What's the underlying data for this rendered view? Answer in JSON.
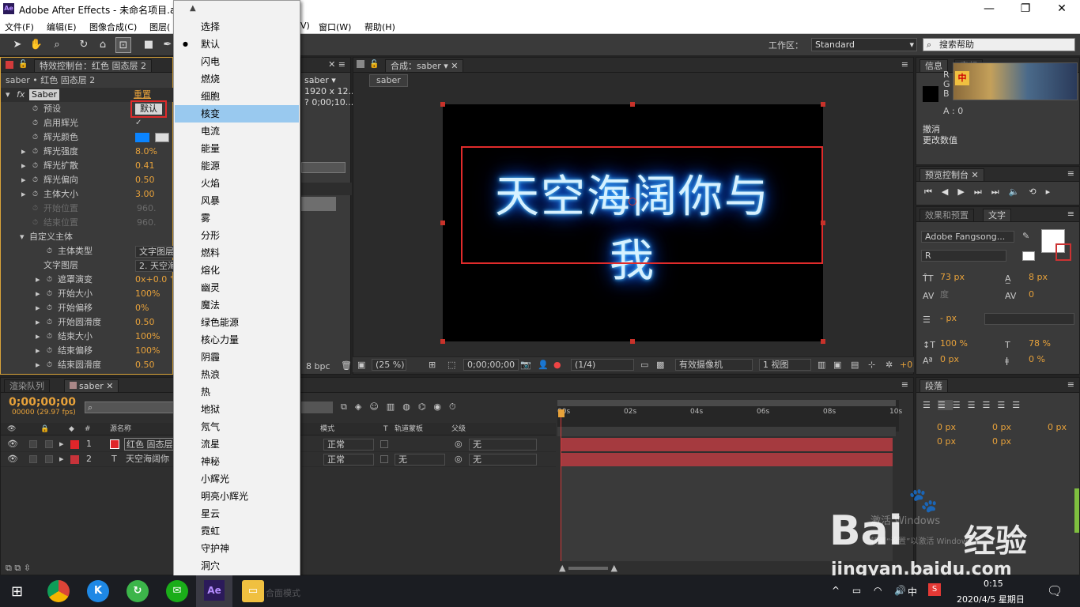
{
  "window": {
    "app_icon": "Ae",
    "title": "Adobe After Effects - 未命名项目.a",
    "min_glyph": "—",
    "max_glyph": "❐",
    "close_glyph": "✕"
  },
  "menu": [
    "文件(F)",
    "编辑(E)",
    "图像合成(C)",
    "图层(",
    "V)",
    "窗口(W)",
    "帮助(H)"
  ],
  "toolbar": {
    "workspace_label": "工作区：",
    "workspace_value": "Standard",
    "help_search_placeholder": "搜索帮助"
  },
  "effect_controls": {
    "tab_label": "特效控制台：红色 固态层",
    "tab_num": "2",
    "layer_path": "saber • 红色 固态层 2",
    "effect_name": "Saber",
    "reset_label": "重置",
    "properties": [
      {
        "label": "预设",
        "value": "默认"
      },
      {
        "label": "启用辉光",
        "value": "✓"
      },
      {
        "label": "辉光颜色",
        "value": ""
      },
      {
        "label": "辉光强度",
        "value": "8.0%"
      },
      {
        "label": "辉光扩散",
        "value": "0.41"
      },
      {
        "label": "辉光偏向",
        "value": "0.50"
      },
      {
        "label": "主体大小",
        "value": "3.00"
      },
      {
        "label": "开始位置",
        "value": "960."
      },
      {
        "label": "结束位置",
        "value": "960."
      },
      {
        "label": "自定义主体",
        "value": ""
      },
      {
        "label": "主体类型",
        "value": "文字图层"
      },
      {
        "label": "文字图层",
        "value": "2. 天空海"
      },
      {
        "label": "遮罩演变",
        "value": "0x+0.0 °"
      },
      {
        "label": "开始大小",
        "value": "100%"
      },
      {
        "label": "开始偏移",
        "value": "0%"
      },
      {
        "label": "开始圆滑度",
        "value": "0.50"
      },
      {
        "label": "结束大小",
        "value": "100%"
      },
      {
        "label": "结束偏移",
        "value": "100%"
      },
      {
        "label": "结束圆滑度",
        "value": "0.50"
      }
    ],
    "glow_color": "#0a84ff"
  },
  "project": {
    "comp_name": "saber ▾",
    "comp_size": "1920 x 12...",
    "comp_duration": "? 0;00;10...",
    "bpc": "8 bpc"
  },
  "preset_menu": {
    "items": [
      "选择",
      "默认",
      "闪电",
      "燃烧",
      "细胞",
      "核变",
      "电流",
      "能量",
      "能源",
      "火焰",
      "风暴",
      "雾",
      "分形",
      "燃料",
      "熔化",
      "幽灵",
      "魔法",
      "绿色能源",
      "核心力量",
      "阴霾",
      "热浪",
      "热",
      "地狱",
      "氖气",
      "流星",
      "神秘",
      "小辉光",
      "明亮小辉光",
      "星云",
      "霓虹",
      "守护神",
      "洞穴"
    ],
    "checked": "默认",
    "highlighted": "核变"
  },
  "composition": {
    "tab_label": "合成：saber",
    "sub_tab": "saber",
    "neon_text": "天空海阔你与我",
    "zoom": "(25 %)",
    "timecode": "0;00;00;00",
    "resolution": "(1/4)",
    "camera": "有效摄像机",
    "views": "1 视图",
    "offset": "+0"
  },
  "info_panel": {
    "tab_info": "信息",
    "tab_audio": "音频",
    "rgba": [
      "R :",
      "G :",
      "B :",
      "A : 0"
    ],
    "undo_label": "撤消",
    "undo_action": "更改数值"
  },
  "preview": {
    "tab_label": "预览控制台"
  },
  "character": {
    "tab_effects": "效果和预置",
    "tab_text": "文字",
    "font": "Adobe Fangsong...",
    "style": "R",
    "size": "73 px",
    "leading": "8 px",
    "tracking_label": "度",
    "tracking": "0",
    "stroke": "- px",
    "vscale": "100 %",
    "hscale": "78 %",
    "baseline": "0 px",
    "tsume": "0 %"
  },
  "paragraph": {
    "tab_label": "段落",
    "indent_left": "0 px",
    "indent_right": "0 px",
    "indent_first": "0 px",
    "space_before": "0 px",
    "space_after": "0 px"
  },
  "timeline": {
    "tab_render": "渲染队列",
    "tab_comp": "saber",
    "timecode": "0;00;00;00",
    "fps": "00000 (29.97 fps)",
    "col_hash": "#",
    "col_source": "源名称",
    "col_mode": "模式",
    "col_t": "T",
    "col_trkmat": "轨道蒙板",
    "col_parent": "父级",
    "ruler": [
      "00s",
      "02s",
      "04s",
      "06s",
      "08s",
      "10s"
    ],
    "layers": [
      {
        "num": "1",
        "name": "红色 固态层",
        "mode": "正常",
        "trkmat": "",
        "parent": "无",
        "color": "#e0262a"
      },
      {
        "num": "2",
        "name": "天空海阔你",
        "mode": "正常",
        "trkmat": "无",
        "parent": "无",
        "color": "#c7333a"
      }
    ]
  },
  "watermark": {
    "activate": "激活 Windows",
    "activate_sub": "转到“设置”以激活 Windows。",
    "brand": "Bai",
    "brand2": "经验",
    "url": "jingyan.baidu.com"
  },
  "taskbar": {
    "time": "0:15",
    "date": "2020/4/5 星期日",
    "ime": "中",
    "extra_label": "合面模式"
  }
}
